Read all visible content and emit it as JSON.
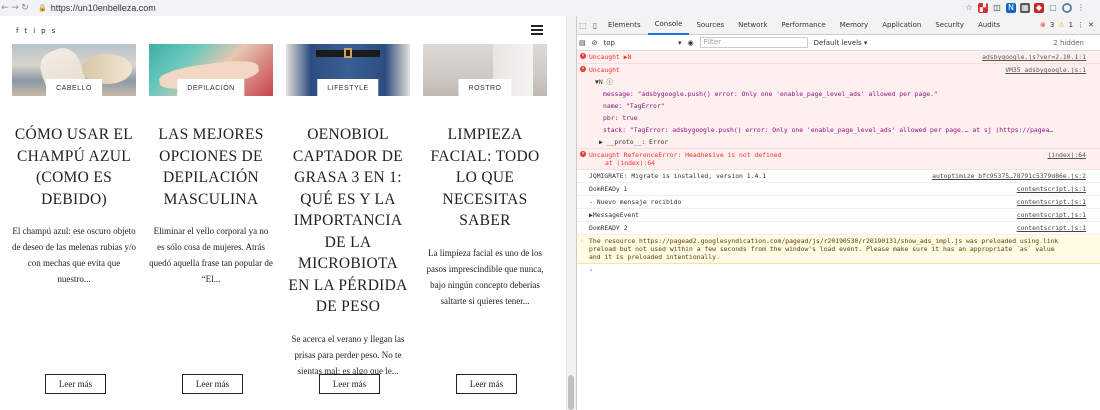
{
  "browser": {
    "url": "https://un10enbelleza.com",
    "back_icon": "arrow-left-icon",
    "forward_icon": "arrow-right-icon",
    "reload_icon": "reload-icon"
  },
  "site": {
    "social_icons": [
      "f",
      "t",
      "i",
      "p",
      "s"
    ],
    "posts": [
      {
        "category": "CABELLO",
        "title": "CÓMO USAR EL CHAMPÚ AZUL (COMO ES DEBIDO)",
        "excerpt": "El champú azul: ese oscuro objeto de deseo de las melenas rubias y/o con mechas que evita que nuestro...",
        "button": "Leer más"
      },
      {
        "category": "DEPILACIÓN",
        "title": "LAS MEJORES OPCIONES DE DEPILACIÓN MASCULINA",
        "excerpt": "Eliminar el vello corporal ya no es sólo cosa de mujeres. Atrás quedó aquella frase tan popular de “El...",
        "button": "Leer más"
      },
      {
        "category": "LIFESTYLE",
        "title": "OENOBIOL CAPTADOR DE GRASA 3 EN 1: QUÉ ES Y LA IMPORTANCIA DE LA MICROBIOTA EN LA PÉRDIDA DE PESO",
        "excerpt": "Se acerca el verano y llegan las prisas para perder peso. No te sientas mal; es algo que le...",
        "button": "Leer más"
      },
      {
        "category": "ROSTRO",
        "title": "LIMPIEZA FACIAL: TODO LO QUE NECESITAS SABER",
        "excerpt": "La limpieza facial es uno de los pasos imprescindible que nunca, bajo ningún concepto deberías saltarte si quieres tener...",
        "button": "Leer más"
      }
    ]
  },
  "devtools": {
    "tabs": [
      "Elements",
      "Console",
      "Sources",
      "Network",
      "Performance",
      "Memory",
      "Application",
      "Security",
      "Audits"
    ],
    "active_tab": "Console",
    "error_count": "3",
    "warning_count": "1",
    "context": "top",
    "filter_placeholder": "Filter",
    "levels": "Default levels ▾",
    "hidden": "2 hidden",
    "messages": [
      {
        "type": "error",
        "text": "Uncaught ▶N",
        "source": "adsbygoogle.js?ver=2.10.1:1"
      },
      {
        "type": "error",
        "text": "Uncaught",
        "source": "VM35 adsbygoogle.js:1"
      },
      {
        "type": "detail",
        "text": "▼N ⓘ"
      },
      {
        "type": "detail",
        "text": "message: \"adsbygoogle.push() error: Only one 'enable_page_level_ads' allowed per page.\""
      },
      {
        "type": "detail",
        "text": "name: \"TagError\""
      },
      {
        "type": "detail",
        "text": "pbr: true"
      },
      {
        "type": "detail",
        "text": "stack: \"TagError: adsbygoogle.push() error: Only one 'enable_page_level_ads' allowed per page.…     at sj (https://pagea…"
      },
      {
        "type": "detail",
        "text": "▶ __proto__: Error"
      },
      {
        "type": "error",
        "text": "Uncaught ReferenceError: Headhesive is not defined",
        "source": "(index):64",
        "sub": "at (index):64"
      },
      {
        "type": "log",
        "text": "JQMIGRATE: Migrate is installed, version 1.4.1",
        "source": "autoptimize_bfc95375…78791c5379d86e.js:2"
      },
      {
        "type": "log",
        "text": "DomREADy 1",
        "source": "contentscript.js:1"
      },
      {
        "type": "log",
        "text": " - Nuevo mensaje recibido",
        "source": "contentscript.js:1"
      },
      {
        "type": "log",
        "text": "▶MessageEvent",
        "source": "contentscript.js:1"
      },
      {
        "type": "log",
        "text": "DomREADY 2",
        "source": "contentscript.js:1"
      },
      {
        "type": "warn",
        "text": "The resource https://pagead2.googlesyndication.com/pagead/js/r20190530/r20190131/show_ads_impl.js was preloaded using link",
        "line2": "preload but not used within a few seconds from the window's load event. Please make sure it has an appropriate `as` value",
        "line3": "and it is preloaded intentionally."
      },
      {
        "type": "prompt",
        "text": "›"
      }
    ]
  }
}
